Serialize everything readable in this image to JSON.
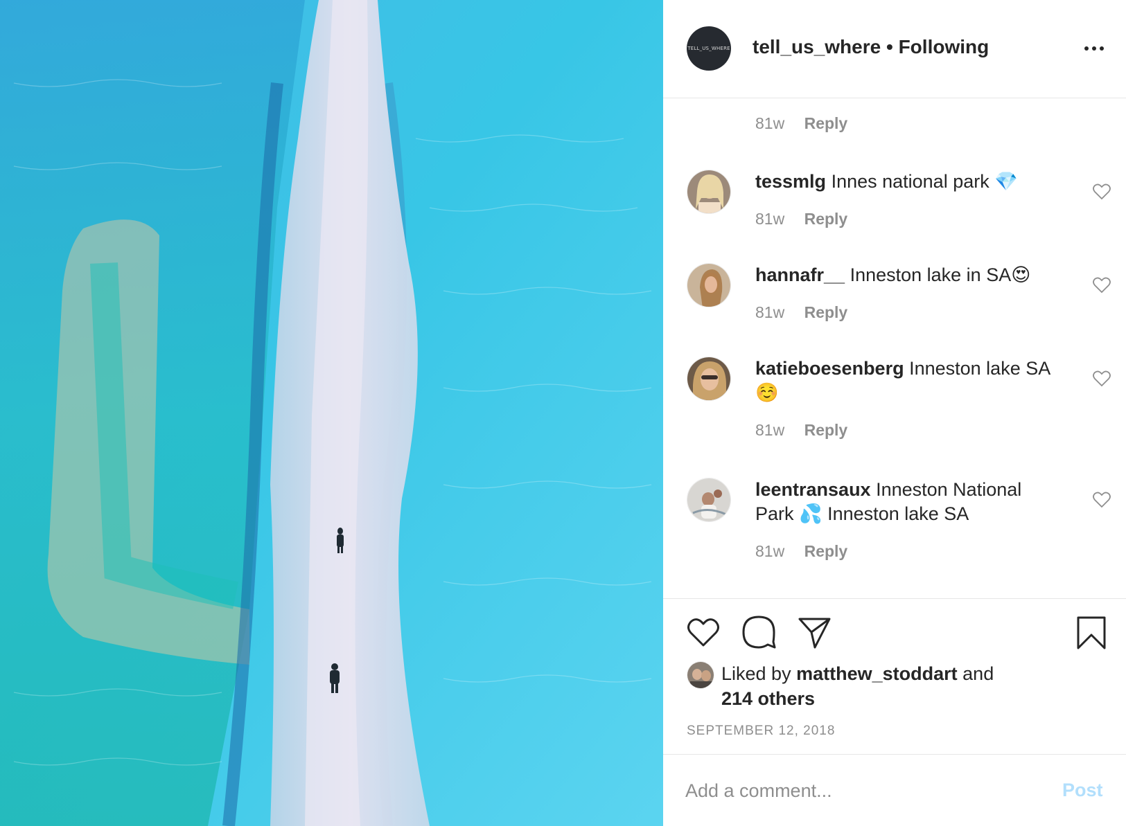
{
  "post": {
    "author": {
      "username": "tell_us_where",
      "separator": "•",
      "follow_status": "Following",
      "avatar_text": "TELL_US_WHERE"
    },
    "more_icon": "more-horizontal-icon"
  },
  "comments": [
    {
      "username": "",
      "text": "",
      "time": "81w",
      "reply": "Reply"
    },
    {
      "username": "tessmlg",
      "text": "Innes national park 💎",
      "time": "81w",
      "reply": "Reply"
    },
    {
      "username": "hannafr__",
      "text": "Inneston lake in SA😍",
      "time": "81w",
      "reply": "Reply"
    },
    {
      "username": "katieboesenberg",
      "text": "Inneston lake SA ☺️",
      "time": "81w",
      "reply": "Reply"
    },
    {
      "username": "leentransaux",
      "text": "Inneston National Park 💦  Inneston lake SA",
      "time": "81w",
      "reply": "Reply"
    }
  ],
  "actions": {
    "like_icon": "heart-icon",
    "comment_icon": "comment-icon",
    "share_icon": "send-icon",
    "save_icon": "bookmark-icon"
  },
  "likes": {
    "prefix": "Liked by",
    "user": "matthew_stoddart",
    "conjunction": "and",
    "others": "214 others"
  },
  "date": "SEPTEMBER 12, 2018",
  "add_comment": {
    "placeholder": "Add a comment...",
    "post_label": "Post"
  },
  "colors": {
    "text": "#262626",
    "secondary": "#8e8e8e",
    "post_button_disabled": "#b2dffc",
    "divider": "#e6e6e6"
  }
}
